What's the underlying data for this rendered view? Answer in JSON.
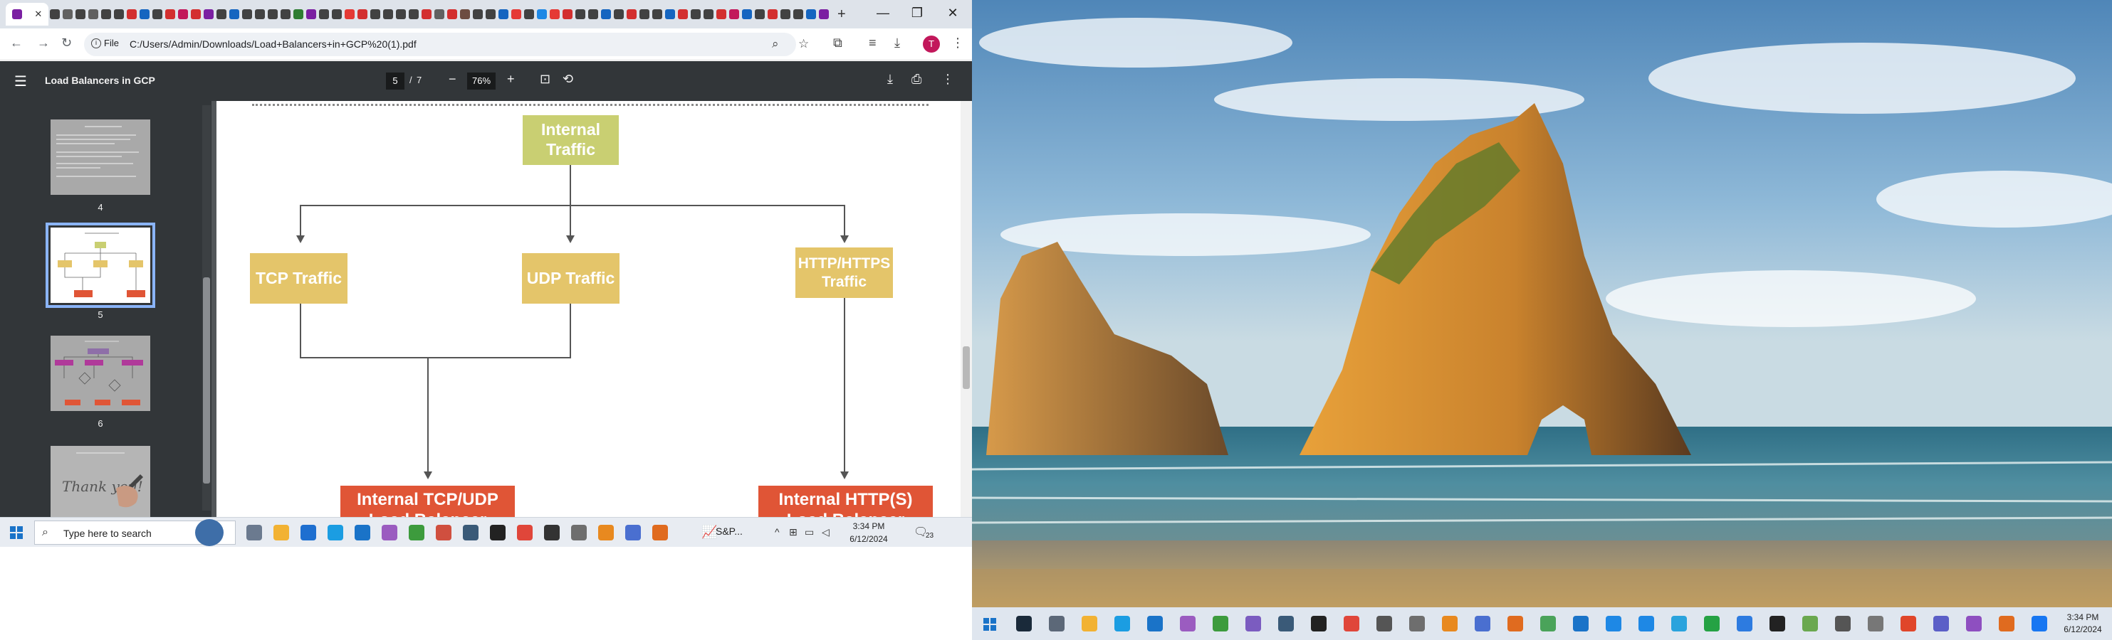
{
  "browser": {
    "url_chip": "File",
    "url": "C:/Users/Admin/Downloads/Load+Balancers+in+GCP%20(1).pdf",
    "profile_initial": "T",
    "tab_close": "✕",
    "new_tab": "+",
    "window_controls": [
      "—",
      "❐",
      "✕"
    ],
    "tab_colors": [
      "#7b1fa2",
      "#424242",
      "#616161",
      "#424242",
      "#616161",
      "#424242",
      "#424242",
      "#d32f2f",
      "#1565c0",
      "#424242",
      "#d32f2f",
      "#c2185b",
      "#d32f2f",
      "#7b1fa2",
      "#424242",
      "#1565c0",
      "#424242",
      "#424242",
      "#424242",
      "#424242",
      "#2e7d32",
      "#7b1fa2",
      "#424242",
      "#424242",
      "#e53935",
      "#d32f2f",
      "#424242",
      "#424242",
      "#424242",
      "#424242",
      "#d32f2f",
      "#616161",
      "#d32f2f",
      "#6d4c41",
      "#424242",
      "#424242",
      "#1565c0",
      "#e53935",
      "#424242",
      "#1e88e5",
      "#e53935",
      "#d32f2f",
      "#424242",
      "#424242",
      "#1565c0",
      "#424242",
      "#d32f2f",
      "#424242",
      "#424242",
      "#1565c0",
      "#d32f2f",
      "#424242",
      "#424242",
      "#d32f2f",
      "#c2185b",
      "#1565c0",
      "#424242",
      "#d32f2f",
      "#424242",
      "#424242",
      "#1565c0",
      "#7b1fa2"
    ]
  },
  "pdf": {
    "title": "Load Balancers in GCP",
    "current_page": "5",
    "page_separator": "/",
    "total_pages": "7",
    "zoom": "76%",
    "thumbnails": [
      {
        "number": "4",
        "selected": false
      },
      {
        "number": "5",
        "selected": true
      },
      {
        "number": "6",
        "selected": false
      },
      {
        "number": "",
        "selected": false
      }
    ],
    "thumb_thankyou": "Thank you!"
  },
  "diagram": {
    "root": "Internal\nTraffic",
    "children": [
      "TCP Traffic",
      "UDP Traffic",
      "HTTP/HTTPS\nTraffic"
    ],
    "leaves": [
      "Internal TCP/UDP Load Balancer",
      "Internal HTTP(S) Load Balancer"
    ]
  },
  "taskbar_left": {
    "search_placeholder": "Type here to search",
    "ticker": "S&P...",
    "time": "3:34 PM",
    "date": "6/12/2024",
    "notif_count": "23"
  },
  "taskbar_right": {
    "time": "3:34 PM",
    "date": "6/12/2024"
  }
}
